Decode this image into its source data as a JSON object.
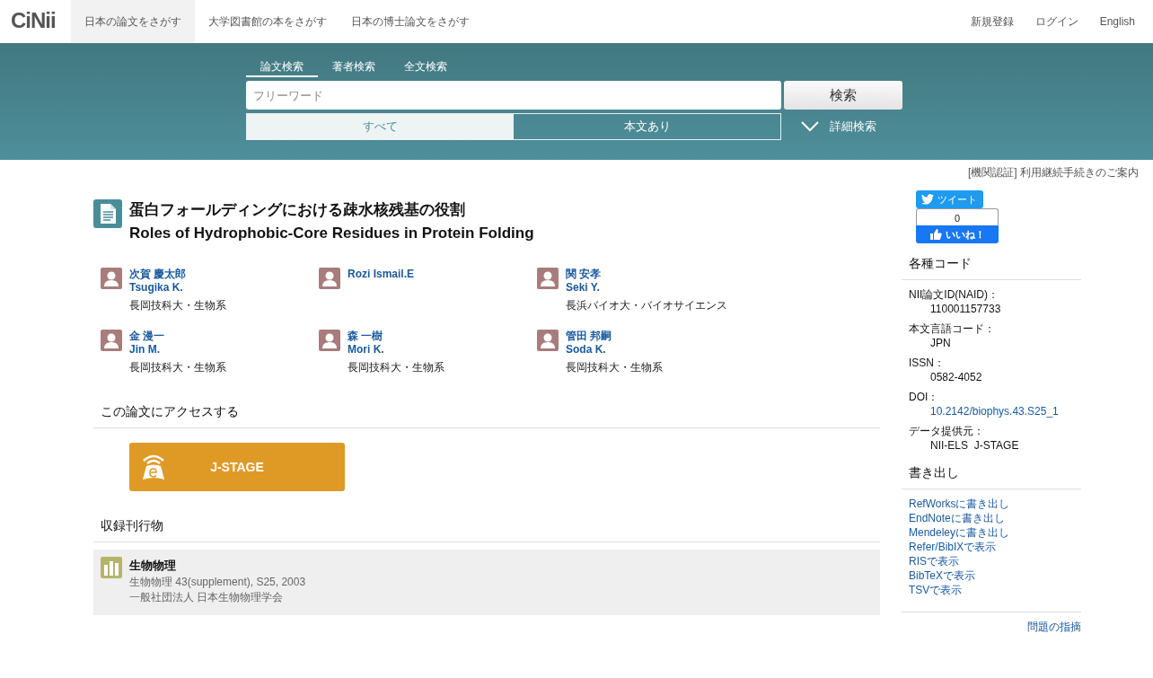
{
  "header": {
    "logo": "CiNii",
    "nav": [
      {
        "label": "日本の論文をさがす",
        "selected": true
      },
      {
        "label": "大学図書館の本をさがす",
        "selected": false
      },
      {
        "label": "日本の博士論文をさがす",
        "selected": false
      }
    ],
    "links": [
      "新規登録",
      "ログイン",
      "English"
    ]
  },
  "search": {
    "tabs": [
      {
        "label": "論文検索",
        "selected": true
      },
      {
        "label": "著者検索",
        "selected": false
      },
      {
        "label": "全文検索",
        "selected": false
      }
    ],
    "placeholder": "フリーワード",
    "button": "検索",
    "filters": [
      {
        "label": "すべて",
        "selected": true
      },
      {
        "label": "本文あり",
        "selected": false
      }
    ],
    "advanced": "詳細検索"
  },
  "notice": "[機関認証] 利用継続手続きのご案内",
  "article": {
    "title_ja": "蛋白フォールディングにおける疎水核残基の役割",
    "title_en": "Roles of Hydrophobic-Core Residues in Protein Folding",
    "authors": [
      {
        "names": [
          "次賀 慶太郎",
          "Tsugika K."
        ],
        "affiliation": "長岡技科大・生物系"
      },
      {
        "names": [
          "Rozi Ismail.E"
        ]
      },
      {
        "names": [
          "関 安孝",
          "Seki Y."
        ],
        "affiliation": "長浜バイオ大・バイオサイエンス"
      },
      {
        "names": [
          "金 漫一",
          "Jin M."
        ],
        "affiliation": "長岡技科大・生物系"
      },
      {
        "names": [
          "森 一樹",
          "Mori K."
        ],
        "affiliation": "長岡技科大・生物系"
      },
      {
        "names": [
          "管田 邦嗣",
          "Soda K."
        ],
        "affiliation": "長岡技科大・生物系"
      }
    ]
  },
  "access": {
    "heading": "この論文にアクセスする",
    "button": "J-STAGE"
  },
  "journal": {
    "heading": "収録刊行物",
    "title": "生物物理",
    "citation": "生物物理 43(supplement), S25, 2003",
    "publisher": "一般社団法人 日本生物物理学会"
  },
  "sidebar": {
    "tweet": "ツイート",
    "like_count": "0",
    "like": "いいね！",
    "codes_heading": "各種コード",
    "codes": [
      {
        "label": "NII論文ID(NAID)：",
        "value": "110001157733",
        "kind": "text"
      },
      {
        "label": "本文言語コード：",
        "value": "JPN",
        "kind": "text"
      },
      {
        "label": "ISSN：",
        "value": "0582-4052",
        "kind": "text"
      },
      {
        "label": "DOI：",
        "value": "10.2142/biophys.43.S25_1",
        "kind": "link"
      },
      {
        "label": "データ提供元：",
        "value": "NII-ELS  J-STAGE",
        "kind": "text"
      }
    ],
    "export_heading": "書き出し",
    "exports": [
      "RefWorksに書き出し",
      "EndNoteに書き出し",
      "Mendeleyに書き出し",
      "Refer/BibIXで表示",
      "RISで表示",
      "BibTeXで表示",
      "TSVで表示"
    ],
    "report": "問題の指摘"
  }
}
